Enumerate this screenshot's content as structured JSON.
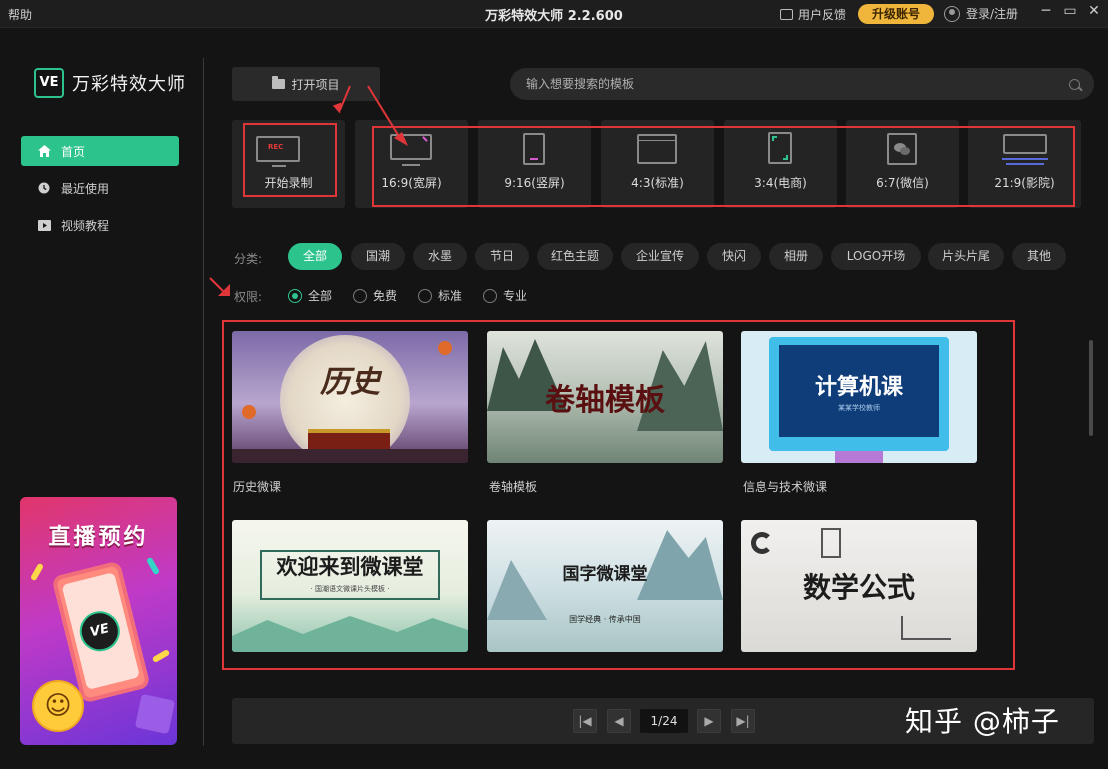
{
  "titlebar": {
    "help": "帮助",
    "title": "万彩特效大师 2.2.600",
    "feedback": "用户反馈",
    "upgrade": "升级账号",
    "login": "登录/注册",
    "min": "─",
    "max": "▭",
    "close": "✕"
  },
  "sidebar": {
    "logo_badge": "VE",
    "logo_text": "万彩特效大师",
    "items": [
      {
        "label": "首页",
        "icon": "home-icon",
        "active": true
      },
      {
        "label": "最近使用",
        "icon": "clock-icon",
        "active": false
      },
      {
        "label": "视频教程",
        "icon": "video-icon",
        "active": false
      }
    ],
    "banner_title": "直播预约",
    "banner_badge": "VE"
  },
  "toolbar": {
    "open_project": "打开项目",
    "search_placeholder": "输入想要搜索的模板"
  },
  "quick": {
    "record": "开始录制",
    "rec_tag": "REC",
    "ratios": [
      "16:9(宽屏)",
      "9:16(竖屏)",
      "4:3(标准)",
      "3:4(电商)",
      "6:7(微信)",
      "21:9(影院)"
    ]
  },
  "filters": {
    "category_label": "分类:",
    "categories": [
      "全部",
      "国潮",
      "水墨",
      "节日",
      "红色主题",
      "企业宣传",
      "快闪",
      "相册",
      "LOGO开场",
      "片头片尾",
      "其他"
    ],
    "permission_label": "权限:",
    "permissions": [
      "全部",
      "免费",
      "标准",
      "专业"
    ]
  },
  "templates": [
    {
      "label": "历史微课",
      "title": "历史"
    },
    {
      "label": "卷轴模板",
      "title": "卷轴模板"
    },
    {
      "label": "信息与技术微课",
      "title": "计算机课",
      "subtitle": "某某学校教师"
    },
    {
      "label": "",
      "title": "欢迎来到微课堂",
      "subtitle": "· 国潮语文微课片头模板 ·"
    },
    {
      "label": "",
      "title": "国字微课堂",
      "subtitle": "国学经典 · 传承中国"
    },
    {
      "label": "",
      "title": "数学公式"
    }
  ],
  "pager": {
    "page": "1/24",
    "first": "|◀",
    "prev": "◀",
    "next": "▶",
    "last": "▶|"
  },
  "watermark": "知乎 @柿子",
  "colors": {
    "accent": "#2dc38c",
    "upgrade": "#f0b63c",
    "highlight": "#e0363a"
  }
}
